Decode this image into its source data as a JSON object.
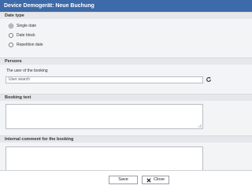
{
  "window": {
    "title": "Device Demogerät: Neue Buchung"
  },
  "date_type": {
    "heading": "Date type",
    "options": [
      {
        "label": "Single date",
        "selected": true
      },
      {
        "label": "Date block",
        "selected": false
      },
      {
        "label": "Repetition date",
        "selected": false
      }
    ]
  },
  "persons": {
    "heading": "Persons",
    "user_label": "The user of the booking",
    "user_search_value": "User search",
    "refresh_icon": "refresh-icon"
  },
  "booking_text": {
    "heading": "Booking text",
    "value": ""
  },
  "internal_comment": {
    "heading": "Internal comment for the booking",
    "value": ""
  },
  "footer": {
    "save_label": "Save",
    "close_label": "Close",
    "close_icon": "close-icon"
  },
  "colors": {
    "titlebar": "#3d6aa8",
    "panel_background": "#f3f4f6",
    "section_header": "#e6e7ea"
  }
}
